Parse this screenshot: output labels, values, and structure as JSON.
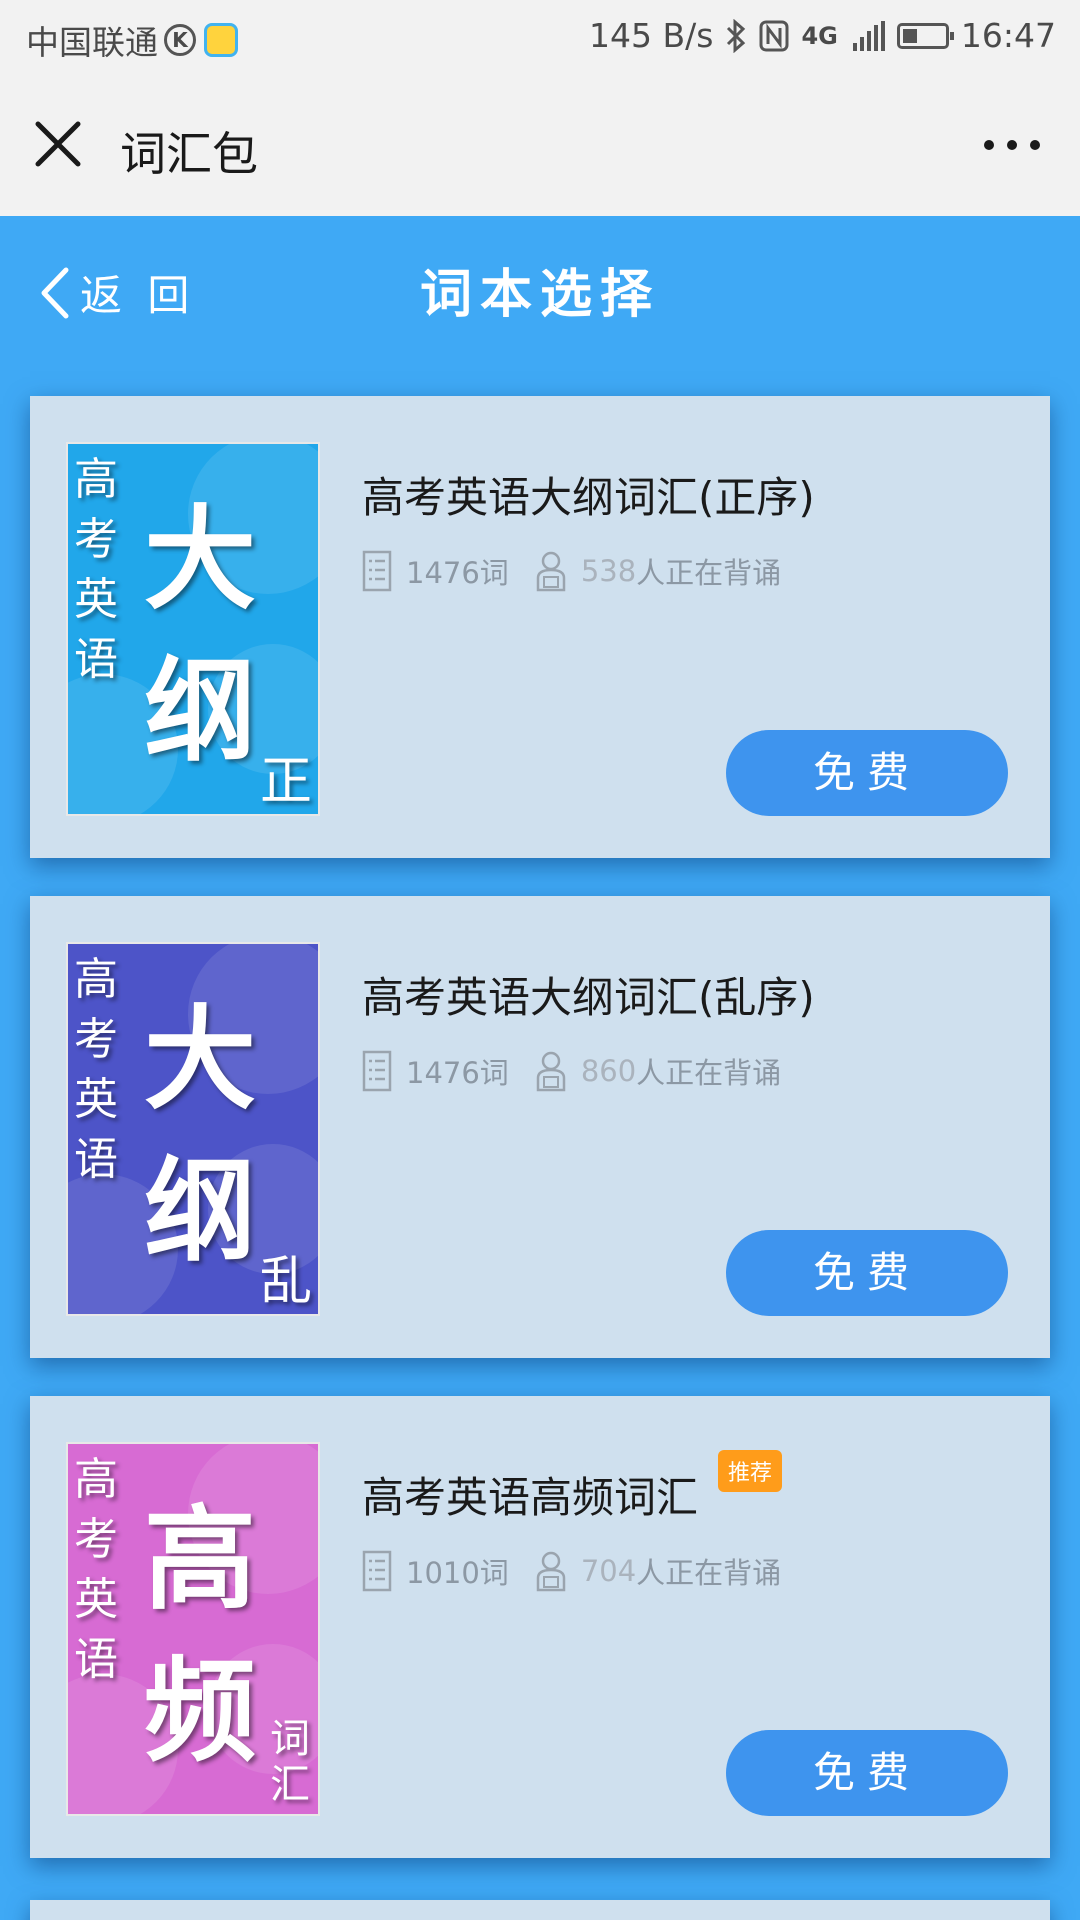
{
  "status_bar": {
    "carrier": "中国联通",
    "k_badge": "K",
    "net_speed": "145 B/s",
    "network_type": "4G",
    "time": "16:47",
    "icons": [
      "bluetooth-icon",
      "nfc-icon",
      "signal-icon",
      "battery-icon"
    ]
  },
  "app_header": {
    "title": "词汇包",
    "close_icon": "close-icon",
    "more_icon": "more-icon"
  },
  "page_nav": {
    "back_label": "返 回",
    "title": "词本选择"
  },
  "colors": {
    "page_bg": "#3fa9f5",
    "card_bg": "#cfe0ee",
    "button": "#3e94ee",
    "badge": "#ff9c1a"
  },
  "books": [
    {
      "title": "高考英语大纲词汇(正序)",
      "word_count": "1476词",
      "learners_count": "538",
      "learners_suffix": "人正在背诵",
      "button_label": "免费",
      "cover": {
        "side_text": "高考英语",
        "big_text": "大纲",
        "tag": "正",
        "color": "#21a7ea"
      }
    },
    {
      "title": "高考英语大纲词汇(乱序)",
      "word_count": "1476词",
      "learners_count": "860",
      "learners_suffix": "人正在背诵",
      "button_label": "免费",
      "cover": {
        "side_text": "高考英语",
        "big_text": "大纲",
        "tag": "乱",
        "color": "#4d54c8"
      }
    },
    {
      "title": "高考英语高频词汇",
      "badge": "推荐",
      "word_count": "1010词",
      "learners_count": "704",
      "learners_suffix": "人正在背诵",
      "button_label": "免费",
      "cover": {
        "side_text": "高考英语",
        "big_text": "高频",
        "tag": "词汇",
        "color": "#d76bd3"
      }
    }
  ]
}
